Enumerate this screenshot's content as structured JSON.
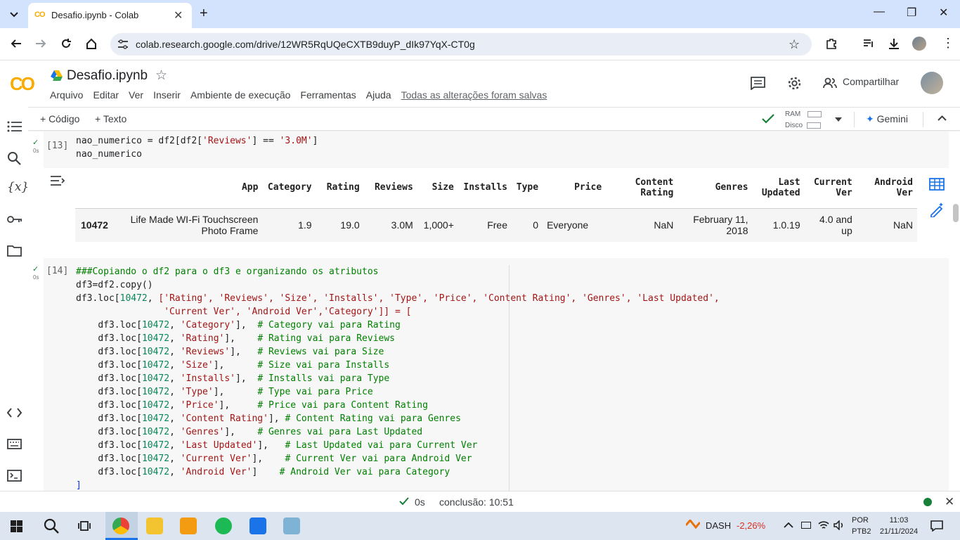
{
  "browser": {
    "tab_title": "Desafio.ipynb - Colab",
    "tab_logo": "CO",
    "url": "colab.research.google.com/drive/12WR5RqUQeCXTB9duyP_dIk97YqX-CT0g"
  },
  "colab": {
    "logo": "CO",
    "notebook_title": "Desafio.ipynb",
    "menu": [
      "Arquivo",
      "Editar",
      "Ver",
      "Inserir",
      "Ambiente de execução",
      "Ferramentas",
      "Ajuda"
    ],
    "saved_status": "Todas as alterações foram salvas",
    "share_label": "Compartilhar"
  },
  "toolbar": {
    "add_code": "+ Código",
    "add_text": "+ Texto",
    "ram_label": "RAM",
    "disk_label": "Disco",
    "gemini_label": "Gemini"
  },
  "cell13": {
    "exec_count": "[13]",
    "time": "0s",
    "line1_var": "nao_numerico = df2[df2[",
    "line1_str1": "'Reviews'",
    "line1_mid": "] == ",
    "line1_str2": "'3.0M'",
    "line1_end": "]",
    "line2": "nao_numerico"
  },
  "dataframe": {
    "columns": [
      "App",
      "Category",
      "Rating",
      "Reviews",
      "Size",
      "Installs",
      "Type",
      "Price",
      "Content Rating",
      "Genres",
      "Last Updated",
      "Current Ver",
      "Android Ver"
    ],
    "row": {
      "index": "10472",
      "values": [
        "Life Made WI-Fi Touchscreen Photo Frame",
        "1.9",
        "19.0",
        "3.0M",
        "1,000+",
        "Free",
        "0",
        "Everyone",
        "NaN",
        "February 11, 2018",
        "1.0.19",
        "4.0 and up",
        "NaN"
      ]
    }
  },
  "cell14": {
    "exec_count": "[14]",
    "time": "0s",
    "comment_header": "###Copiando o df2 para o df3 e organizando os atributos",
    "copy_line": "df3=df2.copy()",
    "loc_prefix": "df3.loc[",
    "loc_index": "10472",
    "loc_list_1": "['Rating', 'Reviews', 'Size', 'Installs', 'Type', 'Price', 'Content Rating', 'Genres', 'Last Updated',",
    "loc_list_2": "'Current Ver', 'Android Ver','Category']] = [",
    "assignments": [
      {
        "col": "'Category'",
        "pad": "],  ",
        "comment": "# Category vai para Rating"
      },
      {
        "col": "'Rating'",
        "pad": "],    ",
        "comment": "# Rating vai para Reviews"
      },
      {
        "col": "'Reviews'",
        "pad": "],   ",
        "comment": "# Reviews vai para Size"
      },
      {
        "col": "'Size'",
        "pad": "],      ",
        "comment": "# Size vai para Installs"
      },
      {
        "col": "'Installs'",
        "pad": "],  ",
        "comment": "# Installs vai para Type"
      },
      {
        "col": "'Type'",
        "pad": "],      ",
        "comment": "# Type vai para Price"
      },
      {
        "col": "'Price'",
        "pad": "],     ",
        "comment": "# Price vai para Content Rating"
      },
      {
        "col": "'Content Rating'",
        "pad": "], ",
        "comment": "# Content Rating vai para Genres"
      },
      {
        "col": "'Genres'",
        "pad": "],    ",
        "comment": "# Genres vai para Last Updated"
      },
      {
        "col": "'Last Updated'",
        "pad": "],   ",
        "comment": "# Last Updated vai para Current Ver"
      },
      {
        "col": "'Current Ver'",
        "pad": "],    ",
        "comment": "# Current Ver vai para Android Ver"
      },
      {
        "col": "'Android Ver'",
        "pad": "]    ",
        "comment": "# Android Ver vai para Category"
      }
    ],
    "closing": "]"
  },
  "status": {
    "elapsed": "0s",
    "completion": "conclusão: 10:51"
  },
  "taskbar": {
    "dash_label": "DASH",
    "dash_change": "-2,26%",
    "lang": "POR",
    "layout": "PTB2",
    "time": "11:03",
    "date": "21/11/2024"
  },
  "colors": {
    "check_green": "#188038",
    "string_red": "#a31515",
    "comment_green": "#008000",
    "colab_orange": "#f9ab00",
    "dash_red": "#d93025"
  }
}
